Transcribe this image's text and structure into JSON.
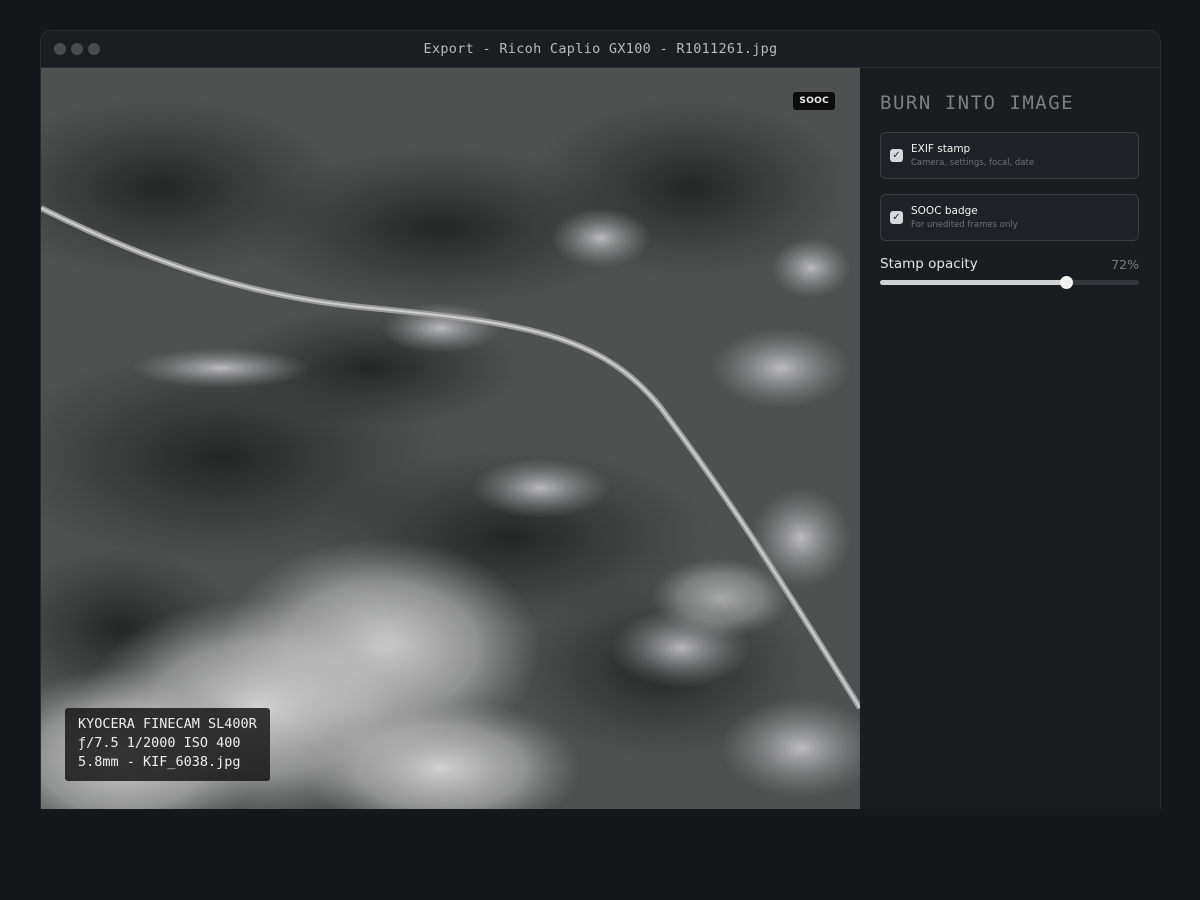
{
  "window": {
    "title": "Export - Ricoh Caplio GX100 - R1011261.jpg"
  },
  "photo": {
    "description_icon": "aerial-photo",
    "sooc_badge": "SOOC",
    "exif_stamp": {
      "line1": "KYOCERA FINECAM SL400R",
      "line2": "ƒ/7.5 1/2000 ISO 400",
      "line3": "5.8mm - KIF_6038.jpg"
    }
  },
  "panel": {
    "title": "BURN INTO IMAGE",
    "options": [
      {
        "label": "EXIF stamp",
        "sublabel": "Camera, settings, focal, date",
        "checked": true
      },
      {
        "label": "SOOC badge",
        "sublabel": "For unedited frames only",
        "checked": true
      }
    ],
    "opacity": {
      "label": "Stamp opacity",
      "value_text": "72%",
      "value": 0.72
    }
  },
  "colors": {
    "background": "#16171b",
    "panel": "#1b1c20",
    "accent": "#cfd0d3"
  }
}
